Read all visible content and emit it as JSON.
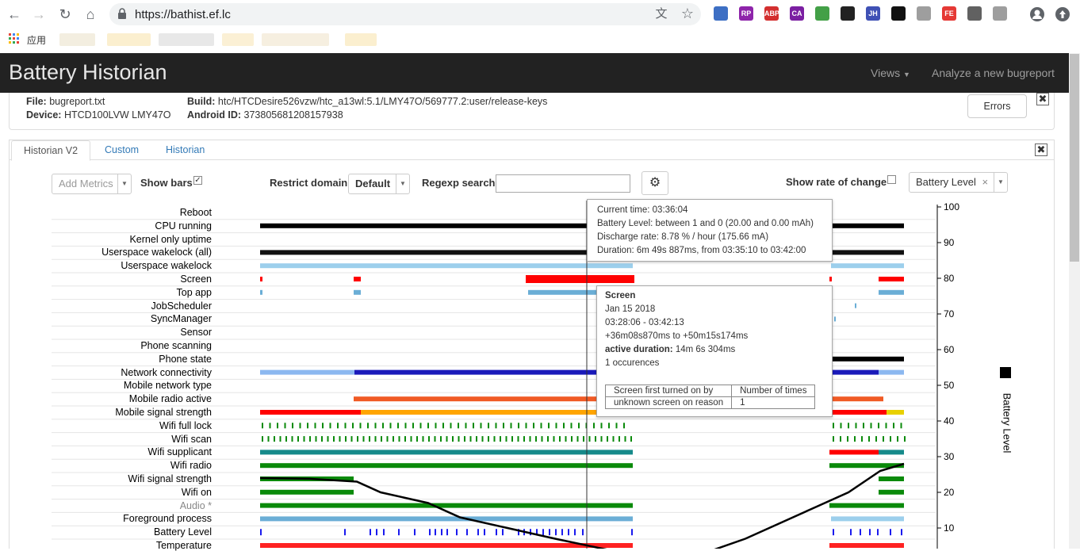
{
  "browser": {
    "url": "https://bathist.ef.lc",
    "apps_label": "应用",
    "extensions": [
      {
        "name": "opera-ext-icon",
        "color": "#3d6fc4",
        "text": ""
      },
      {
        "name": "rp-ext-icon",
        "color": "#8e24aa",
        "text": "RP"
      },
      {
        "name": "abp-ext-icon",
        "color": "#d32f2f",
        "text": "ABP"
      },
      {
        "name": "ca-ext-icon",
        "color": "#7b1fa2",
        "text": "CA"
      },
      {
        "name": "colorful-ext-icon",
        "color": "#43a047",
        "text": ""
      },
      {
        "name": "mask-ext-icon",
        "color": "#222222",
        "text": ""
      },
      {
        "name": "jh-ext-icon",
        "color": "#3f51b5",
        "text": "JH"
      },
      {
        "name": "grid-ext-icon",
        "color": "#111111",
        "text": ""
      },
      {
        "name": "puzzle-ext-icon",
        "color": "#9e9e9e",
        "text": ""
      },
      {
        "name": "fe-ext-icon",
        "color": "#e53935",
        "text": "FE"
      },
      {
        "name": "check-ext-icon",
        "color": "#616161",
        "text": ""
      },
      {
        "name": "printer-ext-icon",
        "color": "#9e9e9e",
        "text": ""
      }
    ]
  },
  "app": {
    "title": "Battery Historian",
    "nav": {
      "views": "Views",
      "analyze": "Analyze a new bugreport"
    }
  },
  "info": {
    "file_label": "File:",
    "file_value": "bugreport.txt",
    "device_label": "Device:",
    "device_value": "HTCD100LVW LMY47O",
    "build_label": "Build:",
    "build_value": "htc/HTCDesire526vzw/htc_a13wl:5.1/LMY47O/569777.2:user/release-keys",
    "android_id_label": "Android ID:",
    "android_id_value": "373805681208157938",
    "errors_button": "Errors"
  },
  "tabs": [
    "Historian V2",
    "Custom",
    "Historian"
  ],
  "controls": {
    "add_metrics_placeholder": "Add Metrics",
    "show_bars_label": "Show bars",
    "show_bars_checked": true,
    "restrict_domain_label": "Restrict domain",
    "restrict_domain_value": "Default",
    "regexp_search_label": "Regexp search",
    "regexp_search_value": "",
    "show_rate_label": "Show rate of change",
    "show_rate_checked": false,
    "metric_select_value": "Battery Level"
  },
  "rows": [
    "Reboot",
    "CPU running",
    "Kernel only uptime",
    "Userspace wakelock (all)",
    "Userspace wakelock",
    "Screen",
    "Top app",
    "JobScheduler",
    "SyncManager",
    "Sensor",
    "Phone scanning",
    "Phone state",
    "Network connectivity",
    "Mobile network type",
    "Mobile radio active",
    "Mobile signal strength",
    "Wifi full lock",
    "Wifi scan",
    "Wifi supplicant",
    "Wifi radio",
    "Wifi signal strength",
    "Wifi on",
    "Audio *",
    "Foreground process",
    "Battery Level",
    "Temperature"
  ],
  "chart_data": {
    "type": "line",
    "ylabel": "Battery Level",
    "ylim": [
      0,
      100
    ],
    "y_ticks": [
      "100",
      "90",
      "80",
      "70",
      "60",
      "50",
      "40",
      "30",
      "20",
      "10"
    ],
    "series": [
      {
        "name": "Battery Level",
        "values": [
          24,
          23,
          20,
          17,
          11,
          7,
          2,
          5,
          10,
          15,
          20,
          24,
          28
        ]
      }
    ]
  },
  "tooltip_battery": {
    "current_time": "Current time: 03:36:04",
    "battery_level": "Battery Level: between 1 and 0 (20.00 and 0.00 mAh)",
    "discharge_rate": "Discharge rate: 8.78 % / hour (175.66 mA)",
    "duration": "Duration: 6m 49s 887ms, from 03:35:10 to 03:42:00"
  },
  "tooltip_screen": {
    "title": "Screen",
    "date": "Jan 15 2018",
    "range": "03:28:06 - 03:42:13",
    "offset": "+36m08s870ms to +50m15s174ms",
    "active_label": "active duration:",
    "active_value": "14m 6s 304ms",
    "occurrences": "1 occurences",
    "table_headers": [
      "Screen first turned on by",
      "Number of times"
    ],
    "table_row": [
      "unknown screen on reason",
      "1"
    ]
  }
}
